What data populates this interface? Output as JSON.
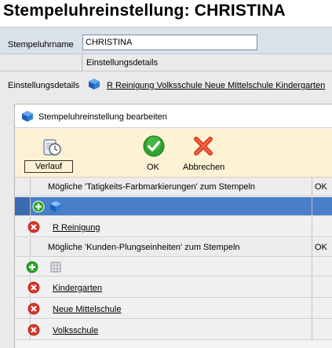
{
  "page": {
    "title": "Stempeluhreinstellung: CHRISTINA"
  },
  "form": {
    "name_label": "Stempeluhrname",
    "name_value": "CHRISTINA",
    "settings_header": "Einstellungsdetails",
    "settings_label": "Einstellungsdetails",
    "settings_value": "R Reinigung Volksschule Neue Mittelschule Kindergarten"
  },
  "dialog": {
    "title": "Stempeluhreinstellung bearbeiten",
    "toolbar": {
      "history_label": "Verlauf",
      "ok_label": "OK",
      "cancel_label": "Abbrechen"
    },
    "sections": [
      {
        "header": "Mögliche 'Tatigkeits-Farbmarkierungen' zum Stempeln",
        "ok_col": "OK",
        "items": [
          "R Reinigung"
        ]
      },
      {
        "header": "Mögliche 'Kunden-Plungseinheiten' zum Stempeln",
        "ok_col": "OK",
        "items": [
          "Kindergarten",
          "Neue Mittelschule",
          "Volksschule"
        ]
      }
    ]
  },
  "icons": {
    "cube": "cube-icon",
    "history": "history-icon",
    "ok": "check-icon",
    "cancel": "x-icon",
    "add": "plus-icon",
    "delete": "delete-icon",
    "grid": "grid-icon"
  },
  "colors": {
    "selection": "#4a7ec9",
    "toolbar": "#fdf3d4",
    "ok_green": "#2fa12f",
    "cancel_red": "#e03a1c",
    "delete_red": "#d8372a",
    "add_green": "#2aa52a"
  }
}
